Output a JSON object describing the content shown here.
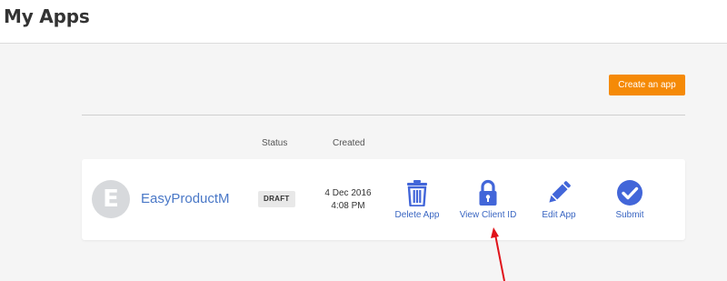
{
  "header": {
    "title": "My Apps"
  },
  "toolbar": {
    "create_label": "Create an app"
  },
  "columns": {
    "status": "Status",
    "created": "Created"
  },
  "app": {
    "avatar_letter": "E",
    "name": "EasyProductM",
    "status": "DRAFT",
    "created_date": "4 Dec 2016",
    "created_time": "4:08 PM"
  },
  "actions": [
    {
      "label": "Delete App",
      "icon": "trash-icon"
    },
    {
      "label": "View Client ID",
      "icon": "lock-icon"
    },
    {
      "label": "Edit App",
      "icon": "pencil-icon"
    },
    {
      "label": "Submit",
      "icon": "check-circle-icon"
    }
  ],
  "colors": {
    "accent_orange": "#f58a07",
    "link_blue": "#4a78c7",
    "icon_blue": "#4266d9",
    "annotation_red": "#e0141b"
  }
}
